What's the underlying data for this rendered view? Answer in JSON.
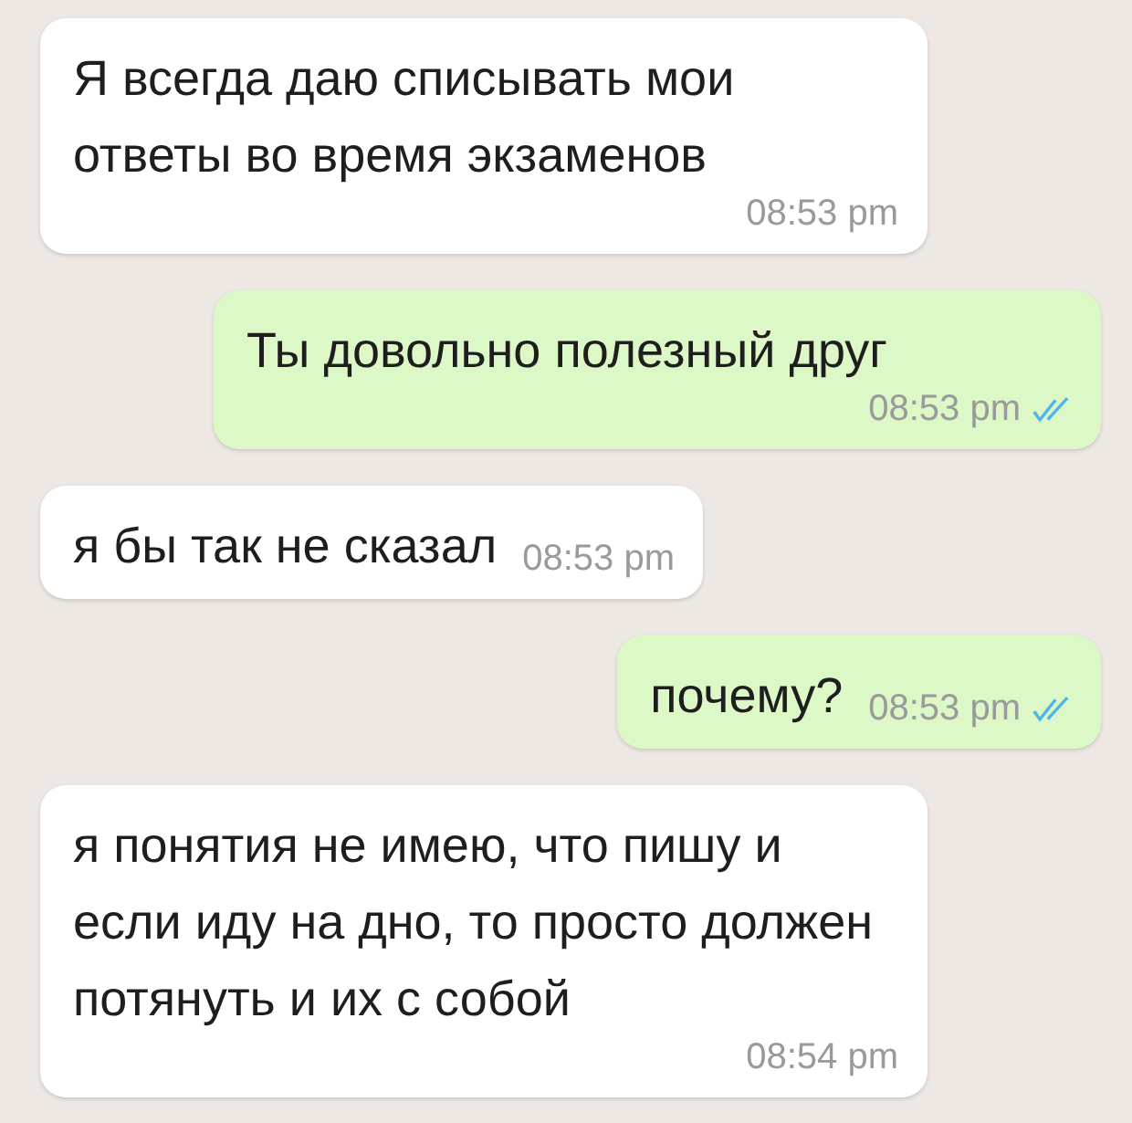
{
  "messages": [
    {
      "outgoing": false,
      "text": "Я всегда даю списывать мои ответы во время экзаменов",
      "time": "08:53 pm"
    },
    {
      "outgoing": true,
      "text": "Ты довольно полезный друг",
      "time": "08:53 pm",
      "read": true
    },
    {
      "outgoing": false,
      "text": "я бы так не сказал",
      "time": "08:53 pm"
    },
    {
      "outgoing": true,
      "text": "почему?",
      "time": "08:53 pm",
      "read": true
    },
    {
      "outgoing": false,
      "text": "я понятия не имею, что пишу и если иду на дно, то просто должен потянуть и их с собой",
      "time": "08:54 pm"
    }
  ]
}
